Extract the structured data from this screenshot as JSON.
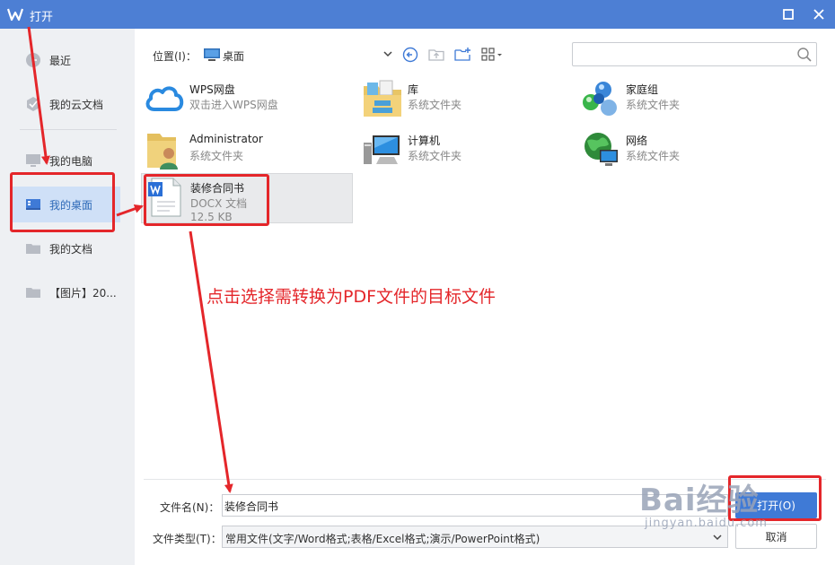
{
  "window": {
    "title": "打开",
    "colors": {
      "titlebar": "#4d7fd4",
      "accent": "#3f7ad6",
      "annotation": "#e4262a"
    }
  },
  "sidebar": {
    "items": [
      {
        "label": "最近",
        "icon": "clock-icon"
      },
      {
        "label": "我的云文档",
        "icon": "cloud-docs-icon"
      },
      {
        "label": "我的电脑",
        "icon": "computer-icon"
      },
      {
        "label": "我的桌面",
        "icon": "desktop-icon",
        "active": true
      },
      {
        "label": "我的文档",
        "icon": "folder-icon"
      },
      {
        "label": "【图片】20...",
        "icon": "folder-icon"
      }
    ]
  },
  "toolbar": {
    "location_label": "位置(I)：",
    "location_value": "桌面",
    "search_placeholder": ""
  },
  "files": [
    {
      "name": "WPS网盘",
      "type": "双击进入WPS网盘",
      "icon": "cloud-icon"
    },
    {
      "name": "库",
      "type": "系统文件夹",
      "icon": "library-icon"
    },
    {
      "name": "家庭组",
      "type": "系统文件夹",
      "icon": "homegroup-icon"
    },
    {
      "name": "Administrator",
      "type": "系统文件夹",
      "icon": "user-folder-icon"
    },
    {
      "name": "计算机",
      "type": "系统文件夹",
      "icon": "computer-icon"
    },
    {
      "name": "网络",
      "type": "系统文件夹",
      "icon": "network-icon"
    },
    {
      "name": "装修合同书",
      "type": "DOCX 文档",
      "size": "12.5 KB",
      "icon": "docx-icon",
      "selected": true
    }
  ],
  "annotation": {
    "text": "点击选择需转换为PDF文件的目标文件"
  },
  "footer": {
    "filename_label": "文件名(N)：",
    "filename_value": "装修合同书",
    "filetype_label": "文件类型(T)：",
    "filetype_value": "常用文件(文字/Word格式;表格/Excel格式;演示/PowerPoint格式)",
    "open_label": "打开(O)",
    "cancel_label": "取消"
  },
  "watermark": {
    "main": "Bai经验",
    "sub": "jingyan.baidu.com"
  }
}
